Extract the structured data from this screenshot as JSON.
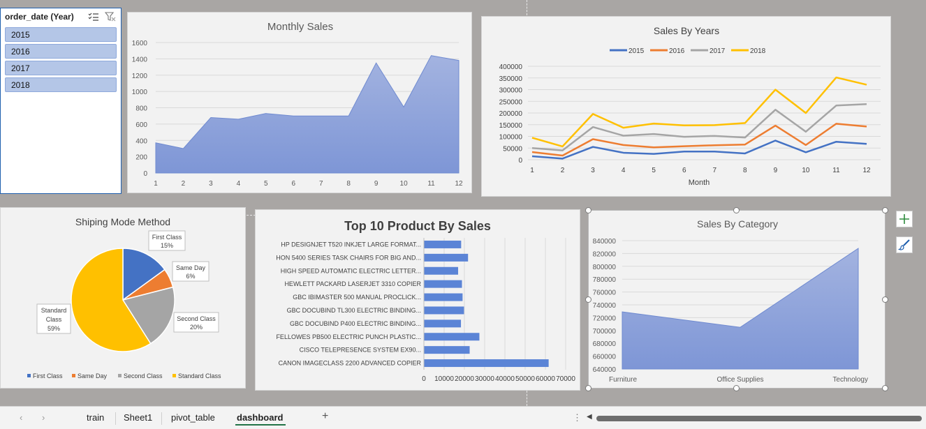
{
  "slicer": {
    "title": "order_date (Year)",
    "items": [
      "2015",
      "2016",
      "2017",
      "2018"
    ]
  },
  "colors": {
    "area_fill_top": "#a3b3e0",
    "area_fill_bottom": "#7e96d6",
    "area_stroke": "#6f8ad0",
    "bar": "#5b84d6",
    "s2015": "#4472c4",
    "s2016": "#ed7d31",
    "s2017": "#a5a5a5",
    "s2018": "#ffc000"
  },
  "chart_data": [
    {
      "id": "monthly",
      "type": "area",
      "title": "Monthly Sales",
      "x": [
        1,
        2,
        3,
        4,
        5,
        6,
        7,
        8,
        9,
        10,
        11,
        12
      ],
      "values": [
        370,
        300,
        680,
        660,
        730,
        700,
        700,
        700,
        1350,
        810,
        1440,
        1380
      ],
      "ylim": [
        0,
        1600
      ],
      "yticks": [
        0,
        200,
        400,
        600,
        800,
        1000,
        1200,
        1400,
        1600
      ],
      "grid": true
    },
    {
      "id": "years",
      "type": "line",
      "title": "Sales By Years",
      "xlabel": "Month",
      "x": [
        1,
        2,
        3,
        4,
        5,
        6,
        7,
        8,
        9,
        10,
        11,
        12
      ],
      "ylim": [
        0,
        400000
      ],
      "yticks": [
        0,
        50000,
        100000,
        150000,
        200000,
        250000,
        300000,
        350000,
        400000
      ],
      "legend_position": "top",
      "series": [
        {
          "name": "2015",
          "values": [
            15000,
            5000,
            55000,
            30000,
            25000,
            35000,
            35000,
            27000,
            82000,
            32000,
            77000,
            68000
          ]
        },
        {
          "name": "2016",
          "values": [
            33000,
            18000,
            88000,
            63000,
            53000,
            58000,
            62000,
            65000,
            146000,
            63000,
            154000,
            142000
          ]
        },
        {
          "name": "2017",
          "values": [
            50000,
            40000,
            140000,
            103000,
            110000,
            98000,
            102000,
            95000,
            214000,
            120000,
            232000,
            238000
          ]
        },
        {
          "name": "2018",
          "values": [
            94000,
            57000,
            196000,
            137000,
            155000,
            147000,
            148000,
            157000,
            300000,
            200000,
            352000,
            321000
          ]
        }
      ],
      "grid": true
    },
    {
      "id": "shipping",
      "type": "pie",
      "title": "Shiping Mode Method",
      "slices": [
        {
          "name": "First Class",
          "value": 15,
          "label_name": "First Class",
          "label_pct": "15%"
        },
        {
          "name": "Same Day",
          "value": 6,
          "label_name": "Same Day",
          "label_pct": "6%"
        },
        {
          "name": "Second Class",
          "value": 20,
          "label_name": "Second Class",
          "label_pct": "20%"
        },
        {
          "name": "Standard Class",
          "value": 59,
          "label_name": "Standard Class",
          "label_pct": "59%"
        }
      ],
      "legend_position": "bottom"
    },
    {
      "id": "top10",
      "type": "bar",
      "title": "Top 10 Product By Sales",
      "categories": [
        "HP DESIGNJET T520 INKJET LARGE FORMAT...",
        "HON 5400 SERIES TASK CHAIRS FOR BIG AND...",
        "HIGH SPEED AUTOMATIC ELECTRIC LETTER...",
        "HEWLETT PACKARD LASERJET 3310 COPIER",
        "GBC IBIMASTER 500 MANUAL PROCLICK...",
        "GBC DOCUBIND TL300 ELECTRIC BINDING...",
        "GBC DOCUBIND P400 ELECTRIC BINDING...",
        "FELLOWES PB500 ELECTRIC PUNCH PLASTIC...",
        "CISCO TELEPRESENCE SYSTEM EX90...",
        "CANON IMAGECLASS 2200 ADVANCED COPIER"
      ],
      "values": [
        18400,
        21800,
        16900,
        18800,
        19100,
        19800,
        18300,
        27400,
        22600,
        61600
      ],
      "xlim": [
        0,
        70000
      ],
      "xticks": [
        0,
        10000,
        20000,
        30000,
        40000,
        50000,
        60000,
        70000
      ],
      "grid": true
    },
    {
      "id": "category",
      "type": "area",
      "title": "Sales By Category",
      "categories": [
        "Furniture",
        "Office Supplies",
        "Technology"
      ],
      "values": [
        729000,
        705000,
        828000
      ],
      "ylim": [
        640000,
        840000
      ],
      "yticks": [
        640000,
        660000,
        680000,
        700000,
        720000,
        740000,
        760000,
        780000,
        800000,
        820000,
        840000
      ],
      "grid": true
    }
  ],
  "tabs": {
    "items": [
      "train",
      "Sheet1",
      "pivot_table",
      "dashboard"
    ],
    "active": "dashboard",
    "add_label": "+",
    "prev": "‹",
    "next": "›",
    "more": "⋮",
    "scroll_left": "◀"
  }
}
